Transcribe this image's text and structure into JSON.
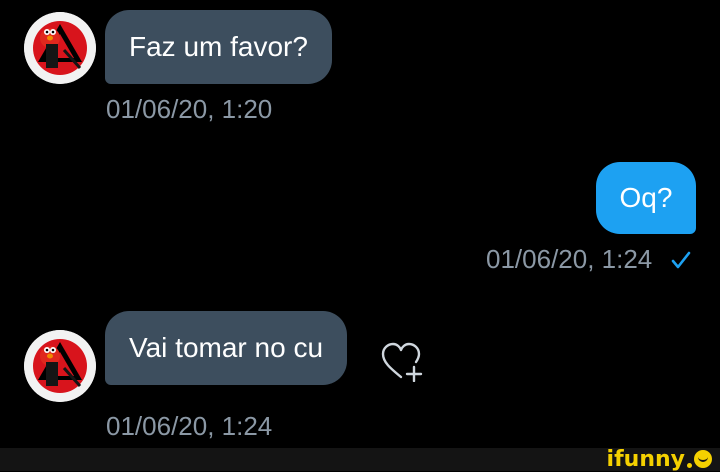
{
  "messages": [
    {
      "direction": "received",
      "text": "Faz um favor?",
      "timestamp": "01/06/20, 1:20",
      "avatar_icon": "elmo-avatar"
    },
    {
      "direction": "sent",
      "text": "Oq?",
      "timestamp": "01/06/20, 1:24",
      "status_icon": "read-check-icon"
    },
    {
      "direction": "received",
      "text": "Vai tomar no cu",
      "timestamp": "01/06/20, 1:24",
      "avatar_icon": "elmo-avatar",
      "reaction_icon": "add-reaction-heart-icon"
    }
  ],
  "watermark": {
    "text": "ifunny",
    "brand_color": "#f5d100"
  },
  "colors": {
    "background": "#000000",
    "received_bubble": "#3d4e5e",
    "sent_bubble": "#1da1f2",
    "timestamp": "#8b98a5",
    "check": "#1da1f2"
  }
}
